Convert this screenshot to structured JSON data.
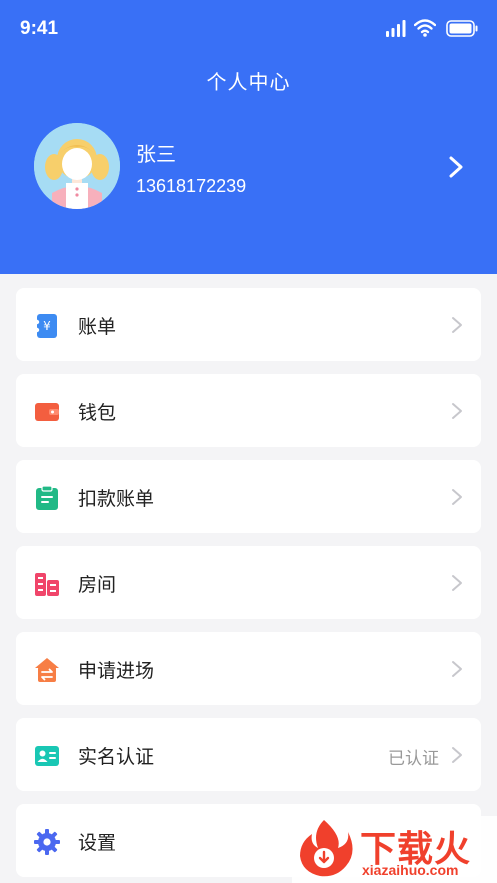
{
  "status_bar": {
    "time": "9:41"
  },
  "header": {
    "title": "个人中心",
    "user_name": "张三",
    "user_phone": "13618172239"
  },
  "menu": {
    "items": [
      {
        "label": "账单",
        "icon": "bill-icon",
        "color": "#3d8bf2"
      },
      {
        "label": "钱包",
        "icon": "wallet-icon",
        "color": "#f35e3f"
      },
      {
        "label": "扣款账单",
        "icon": "clipboard-icon",
        "color": "#21b986"
      },
      {
        "label": "房间",
        "icon": "building-icon",
        "color": "#f0456a"
      },
      {
        "label": "申请进场",
        "icon": "house-exchange-icon",
        "color": "#f77e45"
      },
      {
        "label": "实名认证",
        "icon": "id-card-icon",
        "color": "#19c7b4",
        "status": "已认证"
      },
      {
        "label": "设置",
        "icon": "gear-icon",
        "color": "#4b68f0"
      }
    ]
  },
  "watermark": {
    "brand": "下载火",
    "url": "xiazaihuo.com"
  },
  "colors": {
    "header_bg": "#3970f6",
    "page_bg": "#f4f4f6"
  }
}
